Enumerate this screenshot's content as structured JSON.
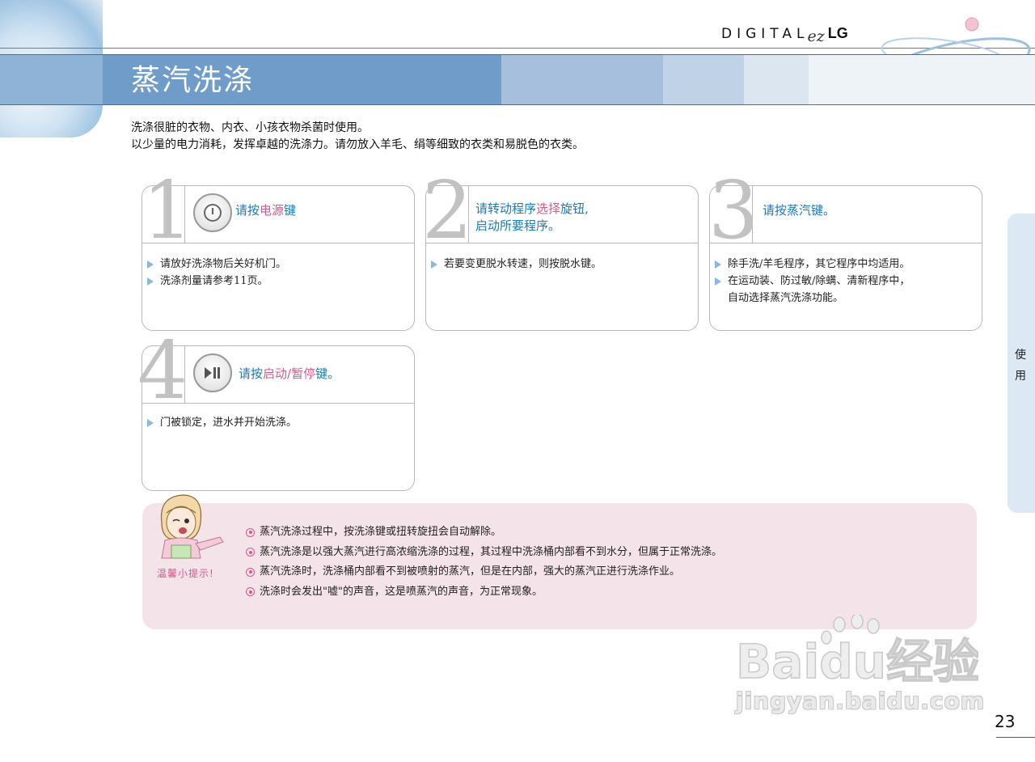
{
  "brand": {
    "digital": "DIGITAL",
    "ez": "ez",
    "lg": "LG"
  },
  "page": {
    "title": "蒸汽洗涤",
    "intro_line1": "洗涤很脏的衣物、内衣、小孩衣物杀菌时使用。",
    "intro_line2": "以少量的电力消耗，发挥卓越的洗涤力。请勿放入羊毛、绢等细致的衣类和易脱色的衣类。",
    "number": "23"
  },
  "steps": [
    {
      "num": "1",
      "icon": "power-icon",
      "title_pre": "请按",
      "title_hl": "电源",
      "title_post": "键",
      "bullets": [
        "请放好洗涤物后关好机门。",
        "洗涤剂量请参考11页。"
      ]
    },
    {
      "num": "2",
      "title_line1_pre": "请转动程序",
      "title_line1_hl": "选择",
      "title_line1_post": "旋钮,",
      "title_line2": "启动所要程序。",
      "bullets": [
        "若要变更脱水转速，则按脱水键。"
      ]
    },
    {
      "num": "3",
      "title": "请按蒸汽键。",
      "bullets": [
        "除手洗/羊毛程序，其它程序中均适用。",
        "在运动装、防过敏/除螨、清新程序中，",
        "自动选择蒸汽洗涤功能。"
      ]
    },
    {
      "num": "4",
      "icon": "play-pause-icon",
      "title_pre": "请按",
      "title_hl": "启动/暂停",
      "title_post": "键。",
      "bullets": [
        "门被锁定，进水并开始洗涤。"
      ]
    }
  ],
  "tip": {
    "label": "温馨小提示!",
    "items": [
      "蒸汽洗涤过程中，按洗涤键或扭转旋扭会自动解除。",
      "蒸汽洗涤是以强大蒸汽进行高浓缩洗涤的过程，其过程中洗涤桶内部看不到水分，但属于正常洗涤。",
      "蒸汽洗涤时，洗涤桶内部看不到被喷射的蒸汽，但是在内部，强大的蒸汽正进行洗涤作业。",
      "洗涤时会发出\"嘘\"的声音，这是喷蒸汽的声音，为正常现象。"
    ]
  },
  "side_tab": {
    "char1": "使",
    "char2": "用"
  },
  "watermark": {
    "logo": "Baidu经验",
    "url": "jingyan.baidu.com"
  },
  "colors": {
    "accent_blue": "#1b7ab8",
    "accent_pink": "#d45a8a",
    "title_bar": "#6f9cc8",
    "tip_bg": "#f5e3ea"
  }
}
